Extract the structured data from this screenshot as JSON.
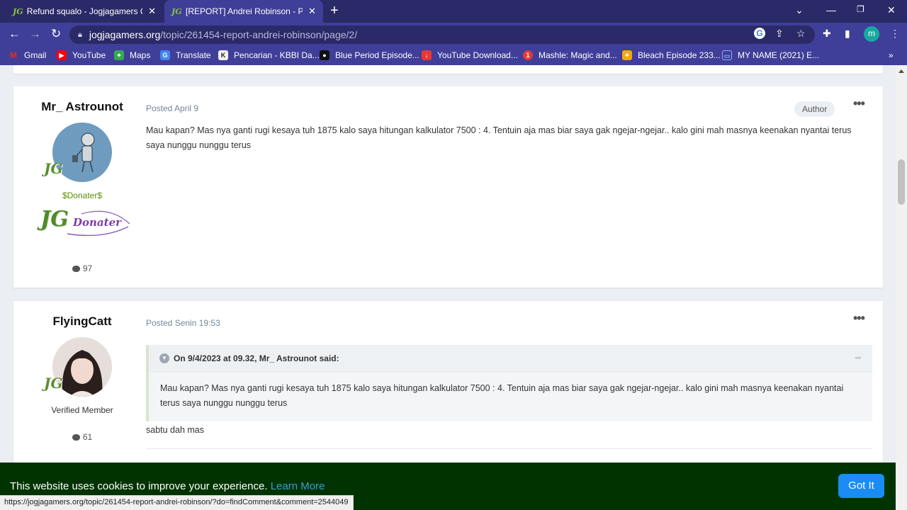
{
  "browser": {
    "tabs": [
      {
        "title": "Refund squalo - Jogjagamers Co",
        "active": false
      },
      {
        "title": "[REPORT] Andrei Robinson - Pag",
        "active": true
      }
    ],
    "favicon_text": "JG",
    "url": {
      "host": "jogjagamers.org",
      "path": "/topic/261454-report-andrei-robinson/page/2/"
    },
    "profile_initial": "m",
    "bookmarks": [
      {
        "label": "Gmail",
        "icon": "gmail-icon",
        "color": "#d93025"
      },
      {
        "label": "YouTube",
        "icon": "youtube-icon",
        "color": "#ff0000"
      },
      {
        "label": "Maps",
        "icon": "maps-icon",
        "color": "#34a853"
      },
      {
        "label": "Translate",
        "icon": "translate-icon",
        "color": "#4285f4"
      },
      {
        "label": "Pencarian - KBBI Da...",
        "icon": "kbbi-icon",
        "color": "#222222"
      },
      {
        "label": "Blue Period Episode...",
        "icon": "blue-period-icon",
        "color": "#111111"
      },
      {
        "label": "YouTube Download...",
        "icon": "download-icon",
        "color": "#e53935"
      },
      {
        "label": "Mashle: Magic and...",
        "icon": "mashle-icon",
        "color": "#e53935"
      },
      {
        "label": "Bleach Episode 233...",
        "icon": "bleach-icon",
        "color": "#f2a900"
      },
      {
        "label": "MY NAME (2021) E...",
        "icon": "tv-icon",
        "color": "#4285f4"
      }
    ],
    "status_url": "https://jogjagamers.org/topic/261454-report-andrei-robinson/?do=findComment&comment=2544049"
  },
  "posts": [
    {
      "username": "Mr_ Astrounot",
      "badge_text": "JG",
      "group": "$Donater$",
      "group_color": "#5a8f00",
      "donater_image": {
        "jg": "JG",
        "label": "Donater"
      },
      "post_count": "97",
      "posted": "Posted April 9",
      "author_badge": "Author",
      "body": "Mau kapan? Mas nya ganti rugi kesaya tuh 1875 kalo saya hitungan kalkulator 7500 : 4. Tentuin aja mas biar saya gak ngejar-ngejar.. kalo gini mah masnya keenakan nyantai terus saya nunggu nunggu terus"
    },
    {
      "username": "FlyingCatt",
      "badge_text": "JG",
      "group": "Verified Member",
      "group_color": "#333333",
      "post_count": "61",
      "posted": "Posted Senin 19:53",
      "quote": {
        "cite": "On 9/4/2023 at 09.32, Mr_ Astrounot said:",
        "body": "Mau kapan? Mas nya ganti rugi kesaya tuh 1875 kalo saya hitungan kalkulator 7500 : 4. Tentuin aja mas biar saya gak ngejar-ngejar.. kalo gini mah masnya keenakan nyantai terus saya nunggu nunggu terus"
      },
      "body": "sabtu dah mas"
    }
  ],
  "cookie_banner": {
    "text": "This website uses cookies to improve your experience.",
    "link": "Learn More",
    "button": "Got It"
  }
}
